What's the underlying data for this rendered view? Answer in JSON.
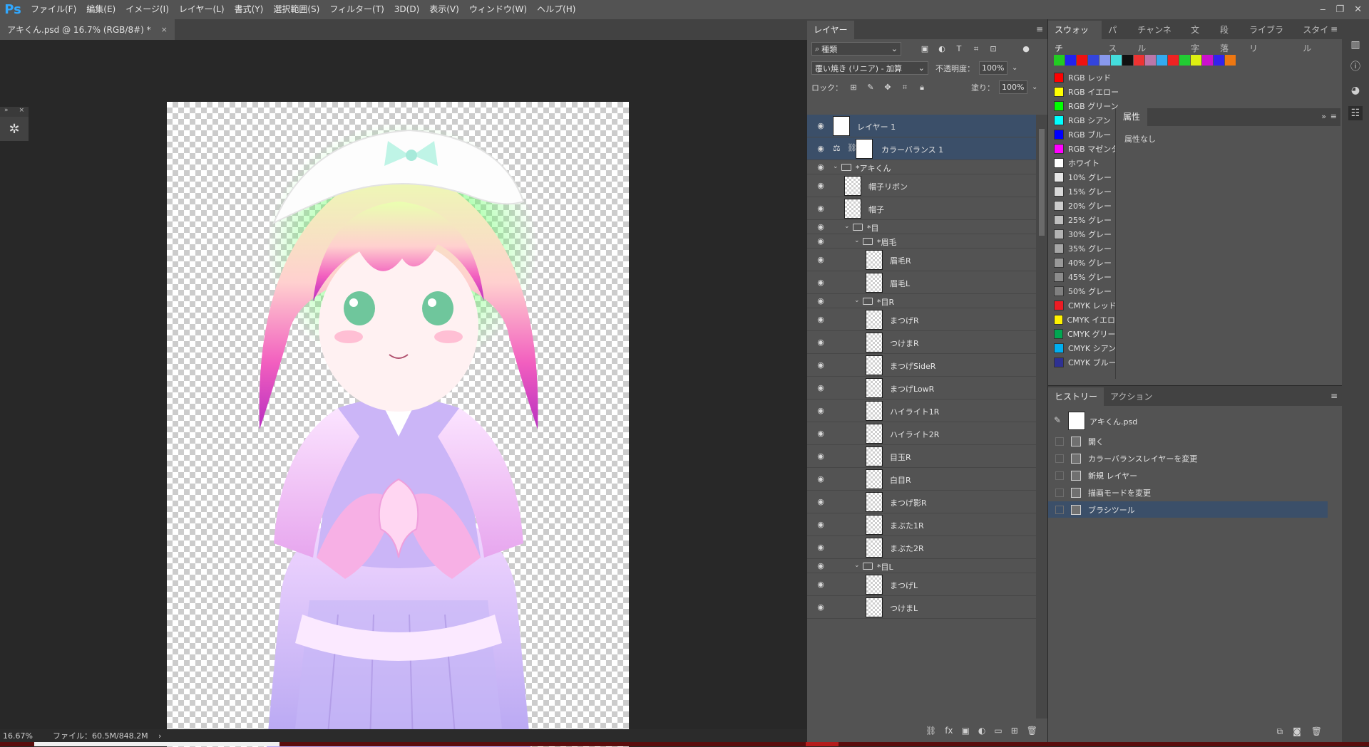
{
  "app": {
    "logo": "Ps"
  },
  "menu": [
    "ファイル(F)",
    "編集(E)",
    "イメージ(I)",
    "レイヤー(L)",
    "書式(Y)",
    "選択範囲(S)",
    "フィルター(T)",
    "3D(D)",
    "表示(V)",
    "ウィンドウ(W)",
    "ヘルプ(H)"
  ],
  "window_controls": {
    "minimize": "‒",
    "restore": "❐",
    "close": "✕"
  },
  "document": {
    "tab_title": "アキくん.psd @ 16.7% (RGB/8#) *",
    "tab_close": "×"
  },
  "status": {
    "zoom": "16.67%",
    "file_info": "ファイル：60.5M/848.2M",
    "arrow": "›"
  },
  "layers_panel": {
    "tabs": [
      "レイヤー"
    ],
    "kind_filter": "種類",
    "blend_mode": "覆い焼き (リニア) - 加算",
    "opacity_label": "不透明度：",
    "opacity_value": "100%",
    "lock_label": "ロック：",
    "fill_label": "塗り：",
    "fill_value": "100%",
    "layers": [
      {
        "name": "レイヤー 1",
        "type": "pixel",
        "indent": 0,
        "selected": true
      },
      {
        "name": "カラーバランス 1",
        "type": "adjustment",
        "indent": 0,
        "selected": true
      },
      {
        "name": "*アキくん",
        "type": "group",
        "indent": 0
      },
      {
        "name": "帽子リボン",
        "type": "pixel",
        "indent": 1
      },
      {
        "name": "帽子",
        "type": "pixel",
        "indent": 1
      },
      {
        "name": "*目",
        "type": "group",
        "indent": 1
      },
      {
        "name": "*眉毛",
        "type": "group",
        "indent": 2
      },
      {
        "name": "眉毛R",
        "type": "pixel",
        "indent": 3
      },
      {
        "name": "眉毛L",
        "type": "pixel",
        "indent": 3
      },
      {
        "name": "*目R",
        "type": "group",
        "indent": 2
      },
      {
        "name": "まつげR",
        "type": "pixel",
        "indent": 3
      },
      {
        "name": "つけまR",
        "type": "pixel",
        "indent": 3
      },
      {
        "name": "まつげSideR",
        "type": "pixel",
        "indent": 3
      },
      {
        "name": "まつげLowR",
        "type": "pixel",
        "indent": 3
      },
      {
        "name": "ハイライト1R",
        "type": "pixel",
        "indent": 3
      },
      {
        "name": "ハイライト2R",
        "type": "pixel",
        "indent": 3
      },
      {
        "name": "目玉R",
        "type": "pixel",
        "indent": 3
      },
      {
        "name": "白目R",
        "type": "pixel",
        "indent": 3
      },
      {
        "name": "まつげ影R",
        "type": "pixel",
        "indent": 3
      },
      {
        "name": "まぶた1R",
        "type": "pixel",
        "indent": 3
      },
      {
        "name": "まぶた2R",
        "type": "pixel",
        "indent": 3
      },
      {
        "name": "*目L",
        "type": "group",
        "indent": 2
      },
      {
        "name": "まつげL",
        "type": "pixel",
        "indent": 3
      },
      {
        "name": "つけまL",
        "type": "pixel",
        "indent": 3
      }
    ]
  },
  "swatch_panel": {
    "tabs": [
      "スウォッチ",
      "パス",
      "チャンネル",
      "文字",
      "段落",
      "ライブラリ",
      "スタイル"
    ],
    "strip_colors": [
      "#22cc22",
      "#2222ee",
      "#ee1111",
      "#3344dd",
      "#8899ee",
      "#44dddd",
      "#111111",
      "#ee3333",
      "#bb77aa",
      "#33aaee",
      "#ee2222",
      "#22cc33",
      "#ddee11",
      "#cc11cc",
      "#3322ee",
      "#ee7711"
    ],
    "swatches": [
      {
        "name": "RGB レッド",
        "color": "#ff0000"
      },
      {
        "name": "RGB イエロー",
        "color": "#ffff00"
      },
      {
        "name": "RGB グリーン",
        "color": "#00ff00"
      },
      {
        "name": "RGB シアン",
        "color": "#00ffff"
      },
      {
        "name": "RGB ブルー",
        "color": "#0000ff"
      },
      {
        "name": "RGB マゼンタ",
        "color": "#ff00ff"
      },
      {
        "name": "ホワイト",
        "color": "#ffffff"
      },
      {
        "name": "10% グレー",
        "color": "#e6e6e6"
      },
      {
        "name": "15% グレー",
        "color": "#d9d9d9"
      },
      {
        "name": "20% グレー",
        "color": "#cccccc"
      },
      {
        "name": "25% グレー",
        "color": "#bfbfbf"
      },
      {
        "name": "30% グレー",
        "color": "#b3b3b3"
      },
      {
        "name": "35% グレー",
        "color": "#a6a6a6"
      },
      {
        "name": "40% グレー",
        "color": "#999999"
      },
      {
        "name": "45% グレー",
        "color": "#8c8c8c"
      },
      {
        "name": "50% グレー",
        "color": "#808080"
      },
      {
        "name": "CMYK レッド",
        "color": "#ed1c24"
      },
      {
        "name": "CMYK イエロー",
        "color": "#fff200"
      },
      {
        "name": "CMYK グリーン",
        "color": "#00a651"
      },
      {
        "name": "CMYK シアン",
        "color": "#00aeef"
      },
      {
        "name": "CMYK ブルー",
        "color": "#2e3192"
      }
    ]
  },
  "properties_panel": {
    "tab": "属性",
    "content": "属性なし"
  },
  "history_panel": {
    "tabs": [
      "ヒストリー",
      "アクション"
    ],
    "snapshot": "アキくん.psd",
    "items": [
      {
        "label": "開く",
        "selected": false
      },
      {
        "label": "カラーバランスレイヤーを変更",
        "selected": false
      },
      {
        "label": "新規 レイヤー",
        "selected": false
      },
      {
        "label": "描画モードを変更",
        "selected": false
      },
      {
        "label": "ブラシツール",
        "selected": true
      }
    ]
  }
}
